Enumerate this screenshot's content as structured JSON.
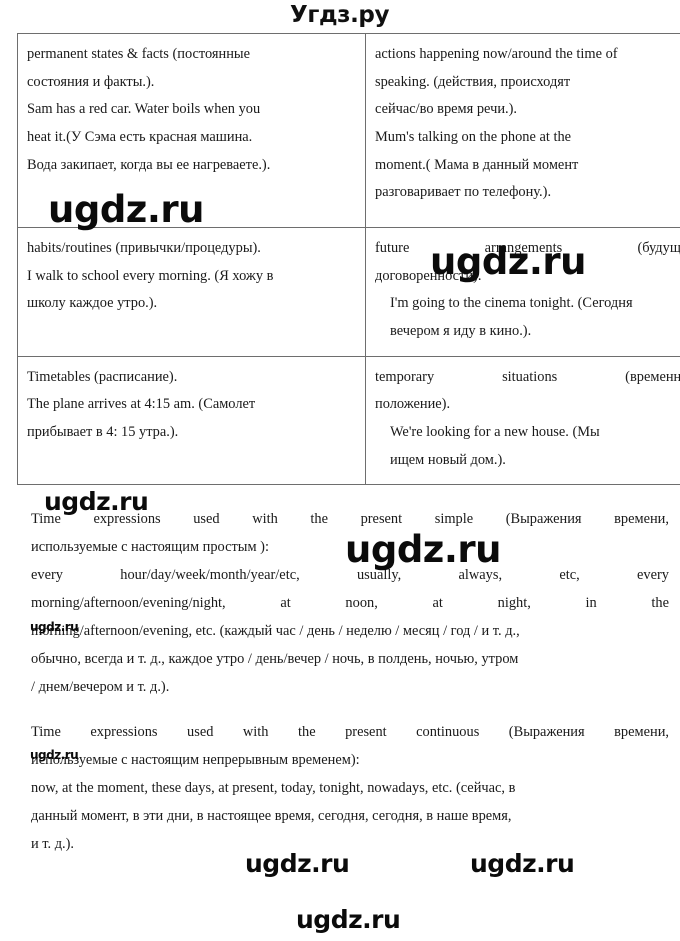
{
  "watermarks": {
    "top_brand": "Угдз.ру",
    "a": "ugdz.ru",
    "b": "ugdz.ru",
    "c": "ugdz.ru",
    "d": "ugdz.ru",
    "e": "ugdz.ru",
    "f": "ugdz.ru",
    "g": "ugdz.ru",
    "h": "ugdz.ru",
    "i": "ugdz.ru"
  },
  "table": {
    "rows": [
      {
        "left": [
          "permanent states & facts (постоянные",
          "состояния и факты.).",
          "Sam has a red car. Water boils when you",
          "heat it.(У Сэма есть красная машина.",
          "Вода закипает, когда вы ее нагреваете.)."
        ],
        "right": [
          "actions happening now/around the time of",
          "speaking. (действия, происходят",
          "сейчас/во время речи.).",
          "Mum's talking on the phone at the",
          "moment.( Мама в данный момент",
          "разговаривает по телефону.)."
        ]
      },
      {
        "left": [
          "habits/routines (привычки/процедуры).",
          "I walk to school every morning. (Я хожу в",
          "школу каждое утро.)."
        ],
        "right": [
          "future arrangements (будущие",
          "договоренности).",
          "I'm going to the cinema tonight. (Сегодня",
          "вечером я иду в кино.)."
        ]
      },
      {
        "left": [
          "Timetables (расписание).",
          "The plane arrives at 4:15 am. (Самолет",
          "прибывает в 4: 15 утра.)."
        ],
        "right": [
          "temporary situations (временное",
          "положение).",
          "We're looking for a new house. (Мы",
          "ищем новый дом.)."
        ]
      }
    ]
  },
  "prose": {
    "para1": {
      "line1": "Time expressions used with the present simple (Выражения времени,",
      "line2": "используемые с настоящим простым ):",
      "line3": "every hour/day/week/month/year/etc, usually, always, etc, every",
      "line4": "morning/afternoon/evening/night, at noon, at night, in the",
      "line5": "morning/afternoon/evening, etc. (каждый час / день / неделю / месяц / год / и т. д.,",
      "line6": "обычно, всегда и т. д., каждое утро / день/вечер / ночь, в полдень, ночью, утром",
      "line7": "/ днем/вечером и т. д.)."
    },
    "para2": {
      "line1": "Time expressions used with the present continuous (Выражения времени,",
      "line2": "используемые с настоящим непрерывным временем):",
      "line3": "now, at the moment, these days, at present, today, tonight, nowadays, etc. (сейчас, в",
      "line4": "данный момент, в эти дни, в настоящее время, сегодня, сегодня, в наше время,",
      "line5": "и т. д.)."
    }
  }
}
